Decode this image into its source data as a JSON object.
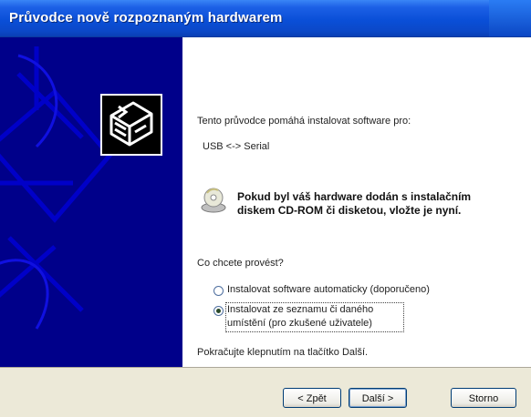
{
  "window": {
    "title": "Průvodce nově rozpoznaným hardwarem"
  },
  "content": {
    "intro": "Tento průvodce pomáhá instalovat software pro:",
    "device": "USB <-> Serial",
    "cd_prompt_line1": "Pokud byl váš hardware dodán s instalačním",
    "cd_prompt_line2": "diskem CD-ROM či disketou, vložte je nyní.",
    "question": "Co chcete provést?",
    "options": [
      {
        "label": "Instalovat software automaticky (doporučeno)",
        "selected": false
      },
      {
        "label_line1": "Instalovat ze seznamu či daného",
        "label_line2": "umístění (pro zkušené uživatele)",
        "selected": true
      }
    ],
    "footer_hint": "Pokračujte klepnutím na tlačítko Další."
  },
  "buttons": {
    "back": "< Zpět",
    "next": "Další >",
    "cancel": "Storno"
  },
  "colors": {
    "banner": "#00008a",
    "titlebar": "#0a4fd8",
    "buttonbar": "#ece9d8"
  },
  "icons": {
    "wizard_logo": "hardware-install-icon",
    "cd": "cd-rom-icon"
  }
}
